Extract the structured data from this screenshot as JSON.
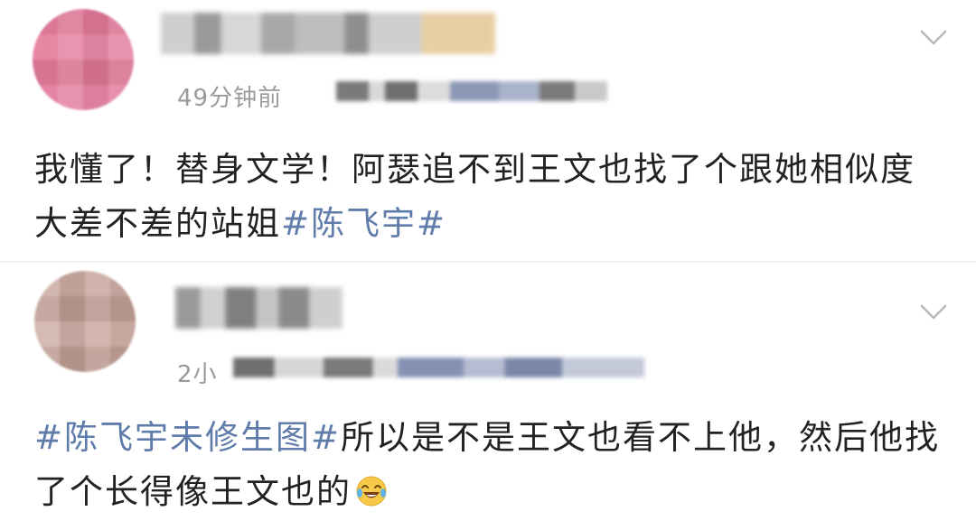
{
  "posts": [
    {
      "timestamp": "49分钟前",
      "comment": {
        "text": "我懂了！替身文学！阿瑟追不到王文也找了个跟她相似度大差不差的站姐",
        "hashtag": "#陈飞宇#"
      }
    },
    {
      "timestamp": "2小",
      "comment": {
        "hashtag": "#陈飞宇未修生图#",
        "text": "所以是不是王文也看不上他，然后他找了个长得像王文也的"
      }
    }
  ],
  "icons": {
    "expand": "chevron-down-icon",
    "emoji": "laughing-tears-emoji-icon"
  },
  "colors": {
    "hashtag": "#5f7cab",
    "timestamp": "#9a9a9a",
    "text": "#222222"
  }
}
